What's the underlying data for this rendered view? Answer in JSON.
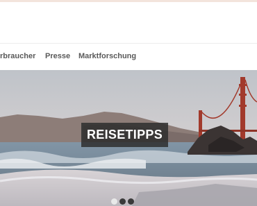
{
  "nav": {
    "items": [
      {
        "label": "rbraucher"
      },
      {
        "label": "Presse"
      },
      {
        "label": "Marktforschung"
      }
    ]
  },
  "hero": {
    "label": "REISETIPPS",
    "colors": {
      "sky": "#c7c8cc",
      "sea": "#7d8fa0",
      "label_bg": "#2e2e2e"
    }
  },
  "carousel": {
    "slide_count": 3,
    "active_index": 0
  }
}
